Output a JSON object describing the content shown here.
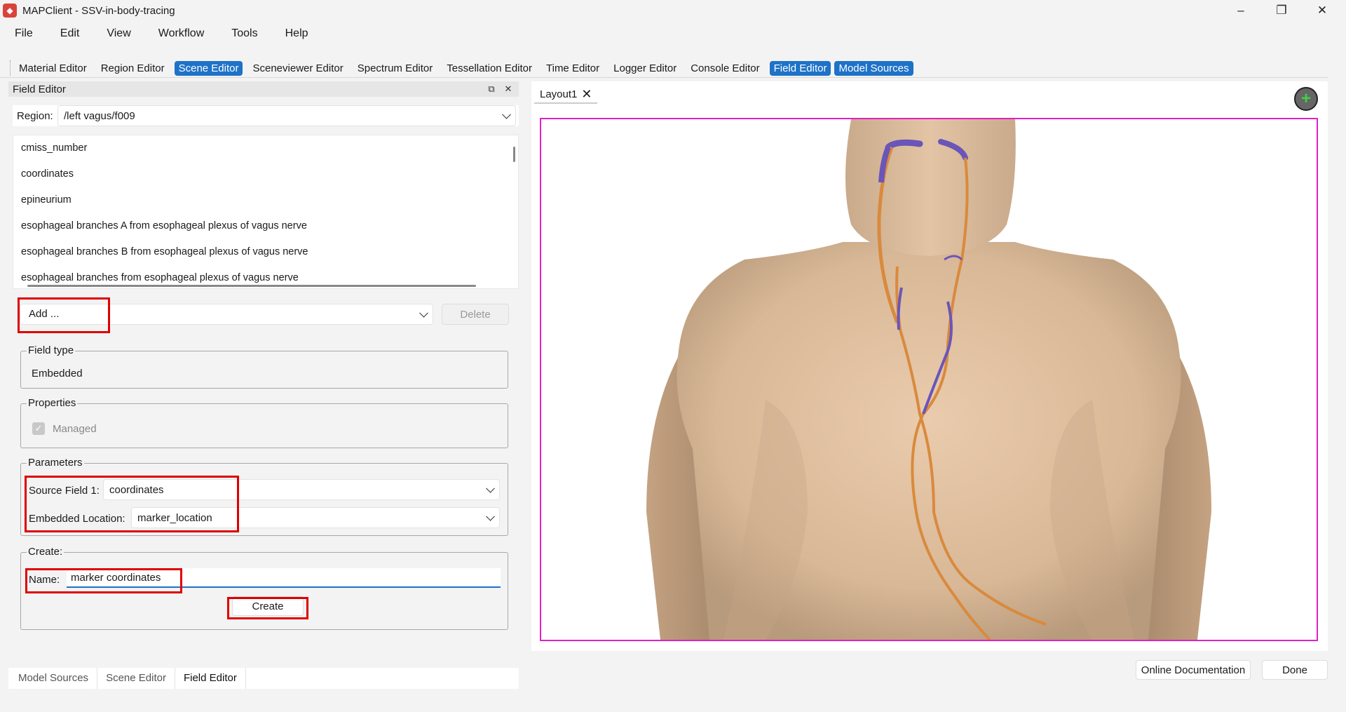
{
  "window": {
    "title": "MAPClient - SSV-in-body-tracing"
  },
  "menu": [
    "File",
    "Edit",
    "View",
    "Workflow",
    "Tools",
    "Help"
  ],
  "toolbar": [
    {
      "label": "Material Editor",
      "active": false
    },
    {
      "label": "Region Editor",
      "active": false
    },
    {
      "label": "Scene Editor",
      "active": true
    },
    {
      "label": "Sceneviewer Editor",
      "active": false
    },
    {
      "label": "Spectrum Editor",
      "active": false
    },
    {
      "label": "Tessellation Editor",
      "active": false
    },
    {
      "label": "Time Editor",
      "active": false
    },
    {
      "label": "Logger Editor",
      "active": false
    },
    {
      "label": "Console Editor",
      "active": false
    },
    {
      "label": "Field Editor",
      "active": true
    },
    {
      "label": "Model Sources",
      "active": true
    }
  ],
  "field_editor": {
    "title": "Field Editor",
    "region_label": "Region:",
    "region_value": "/left vagus/f009",
    "fields": [
      "cmiss_number",
      "coordinates",
      "epineurium",
      "esophageal branches A from esophageal plexus of vagus nerve",
      "esophageal branches B from esophageal plexus of vagus nerve",
      "esophageal branches from esophageal plexus of vagus nerve"
    ],
    "add_label": "Add ...",
    "delete_label": "Delete",
    "field_type_title": "Field type",
    "field_type_value": "Embedded",
    "properties_title": "Properties",
    "managed_label": "Managed",
    "parameters_title": "Parameters",
    "source_field_label": "Source Field 1:",
    "source_field_value": "coordinates",
    "embedded_location_label": "Embedded Location:",
    "embedded_location_value": "marker_location",
    "create_title": "Create:",
    "name_label": "Name:",
    "name_value": "marker coordinates",
    "create_button": "Create"
  },
  "bottom_tabs": [
    "Model Sources",
    "Scene Editor",
    "Field Editor"
  ],
  "layout_tab": "Layout1",
  "footer": {
    "docs_button": "Online Documentation",
    "done_button": "Done"
  },
  "colors": {
    "accent": "#1e72c8",
    "highlight": "#e00000",
    "scene_border": "#e020c8",
    "nerve_orange": "#d98a3d",
    "nerve_purple": "#6a55b8",
    "skin": "#d8bb9c"
  }
}
